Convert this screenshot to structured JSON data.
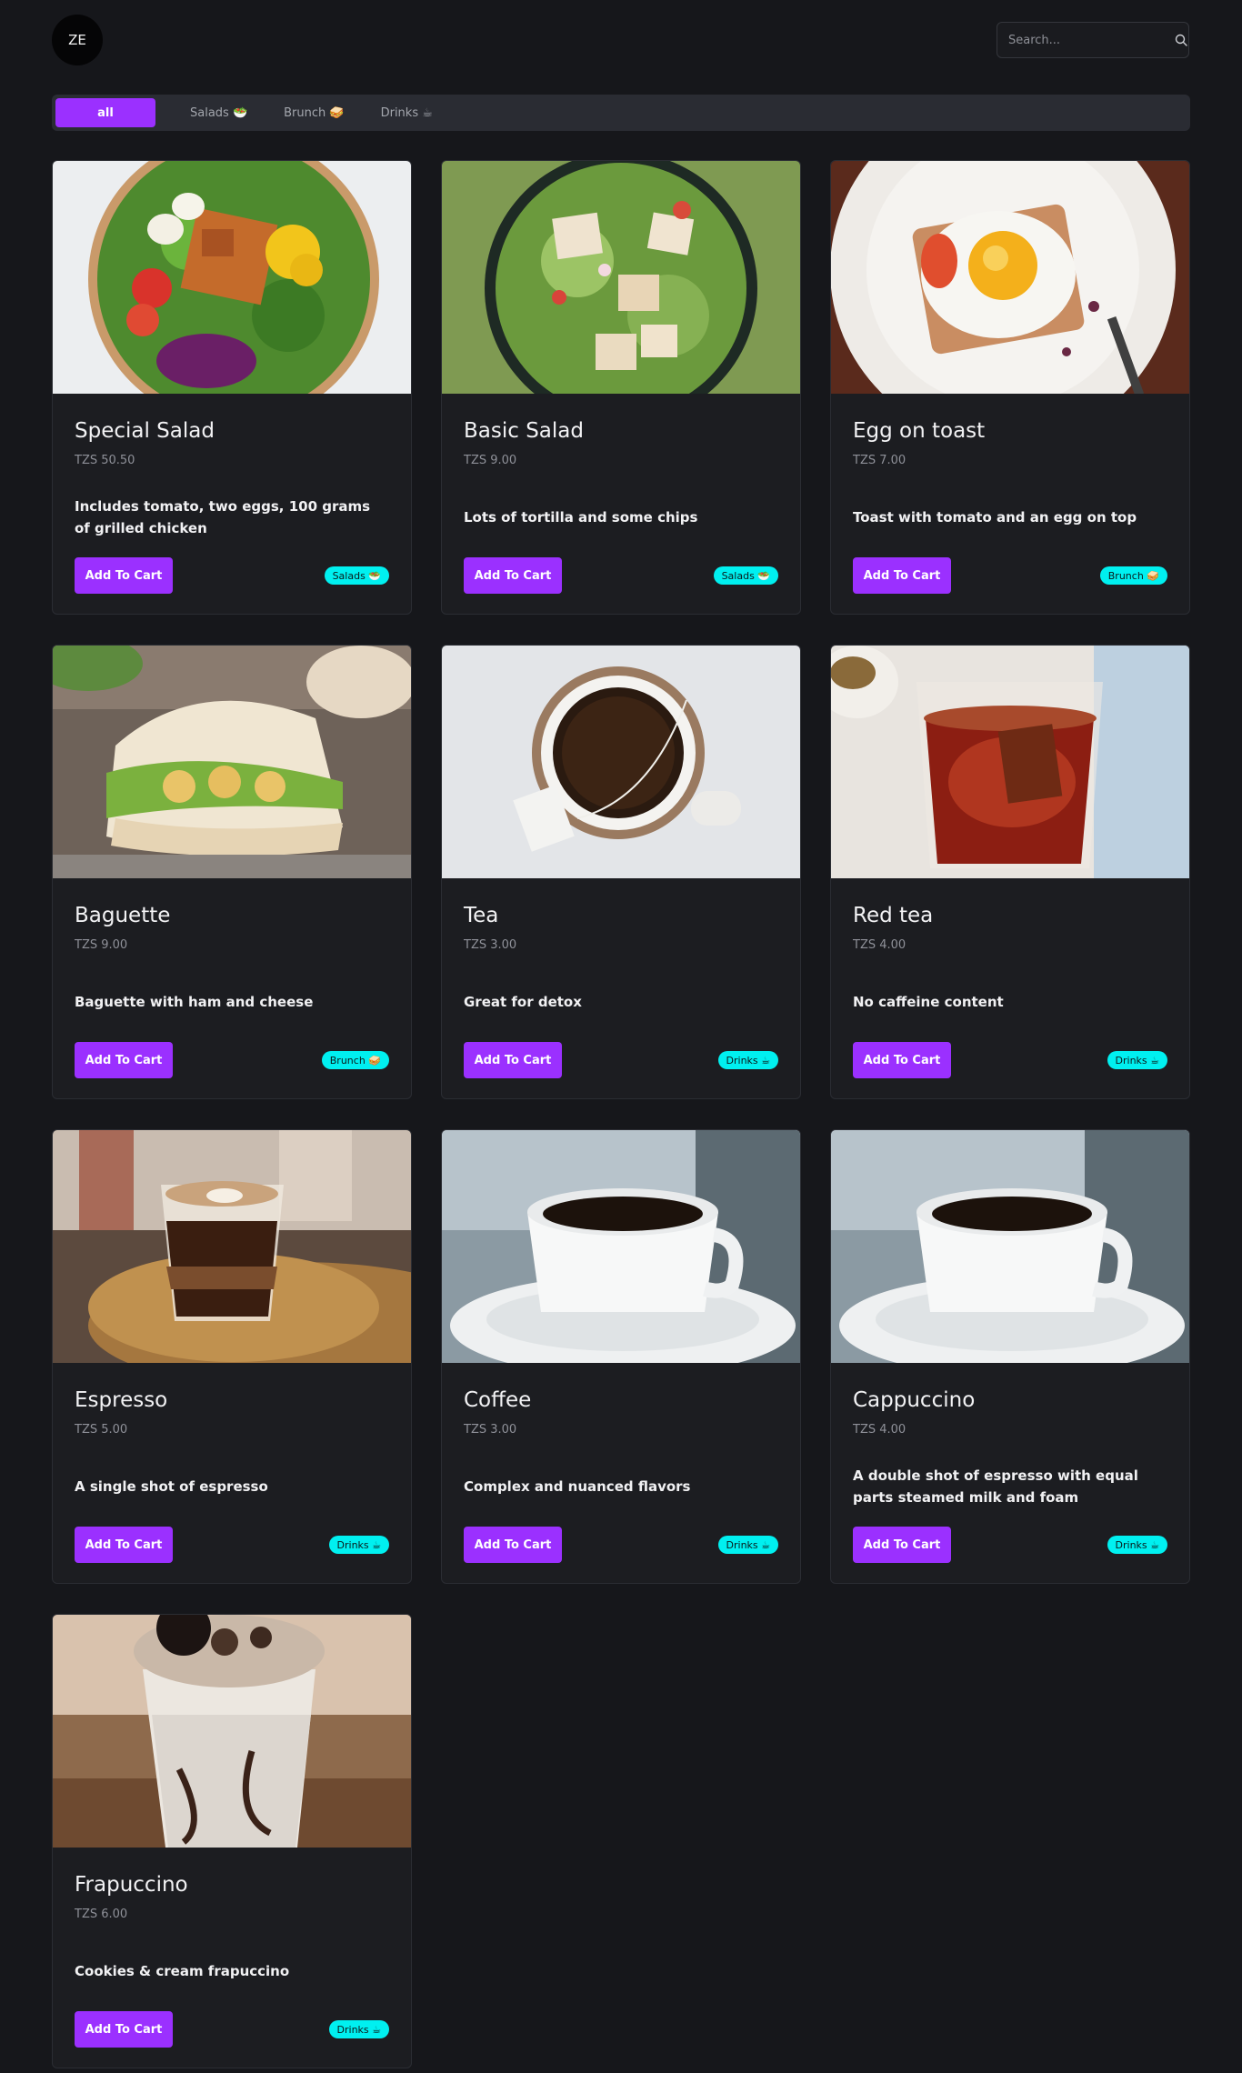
{
  "header": {
    "logo_text": "ZE",
    "search_placeholder": "Search...",
    "search_icon": "search-icon"
  },
  "tabs": [
    {
      "label": "all",
      "active": true
    },
    {
      "label": "Salads 🥗",
      "active": false
    },
    {
      "label": "Brunch 🥪",
      "active": false
    },
    {
      "label": "Drinks ☕",
      "active": false
    }
  ],
  "colors": {
    "background": "#16171b",
    "card": "#1c1d21",
    "accent": "#9b30ff",
    "badge": "#00f0f0"
  },
  "cart_label": "Add To Cart",
  "items": [
    {
      "name": "Special Salad",
      "price": "TZS 50.50",
      "description": "Includes tomato, two eggs, 100 grams of grilled chicken",
      "category": "Salads 🥗",
      "image": "salad-bowl-photo"
    },
    {
      "name": "Basic Salad",
      "price": "TZS 9.00",
      "description": "Lots of tortilla and some chips",
      "category": "Salads 🥗",
      "image": "green-salad-photo"
    },
    {
      "name": "Egg on toast",
      "price": "TZS 7.00",
      "description": "Toast with tomato and an egg on top",
      "category": "Brunch 🥪",
      "image": "egg-toast-photo"
    },
    {
      "name": "Baguette",
      "price": "TZS 9.00",
      "description": "Baguette with ham and cheese",
      "category": "Brunch 🥪",
      "image": "sandwich-photo"
    },
    {
      "name": "Tea",
      "price": "TZS 3.00",
      "description": "Great for detox",
      "category": "Drinks ☕",
      "image": "tea-cup-photo"
    },
    {
      "name": "Red tea",
      "price": "TZS 4.00",
      "description": "No caffeine content",
      "category": "Drinks ☕",
      "image": "red-tea-photo"
    },
    {
      "name": "Espresso",
      "price": "TZS 5.00",
      "description": "A single shot of espresso",
      "category": "Drinks ☕",
      "image": "espresso-photo"
    },
    {
      "name": "Coffee",
      "price": "TZS 3.00",
      "description": "Complex and nuanced flavors",
      "category": "Drinks ☕",
      "image": "coffee-cup-photo"
    },
    {
      "name": "Cappuccino",
      "price": "TZS 4.00",
      "description": "A double shot of espresso with equal parts steamed milk and foam",
      "category": "Drinks ☕",
      "image": "coffee-cup-photo"
    },
    {
      "name": "Frapuccino",
      "price": "TZS 6.00",
      "description": "Cookies & cream frapuccino",
      "category": "Drinks ☕",
      "image": "frappuccino-photo"
    }
  ]
}
